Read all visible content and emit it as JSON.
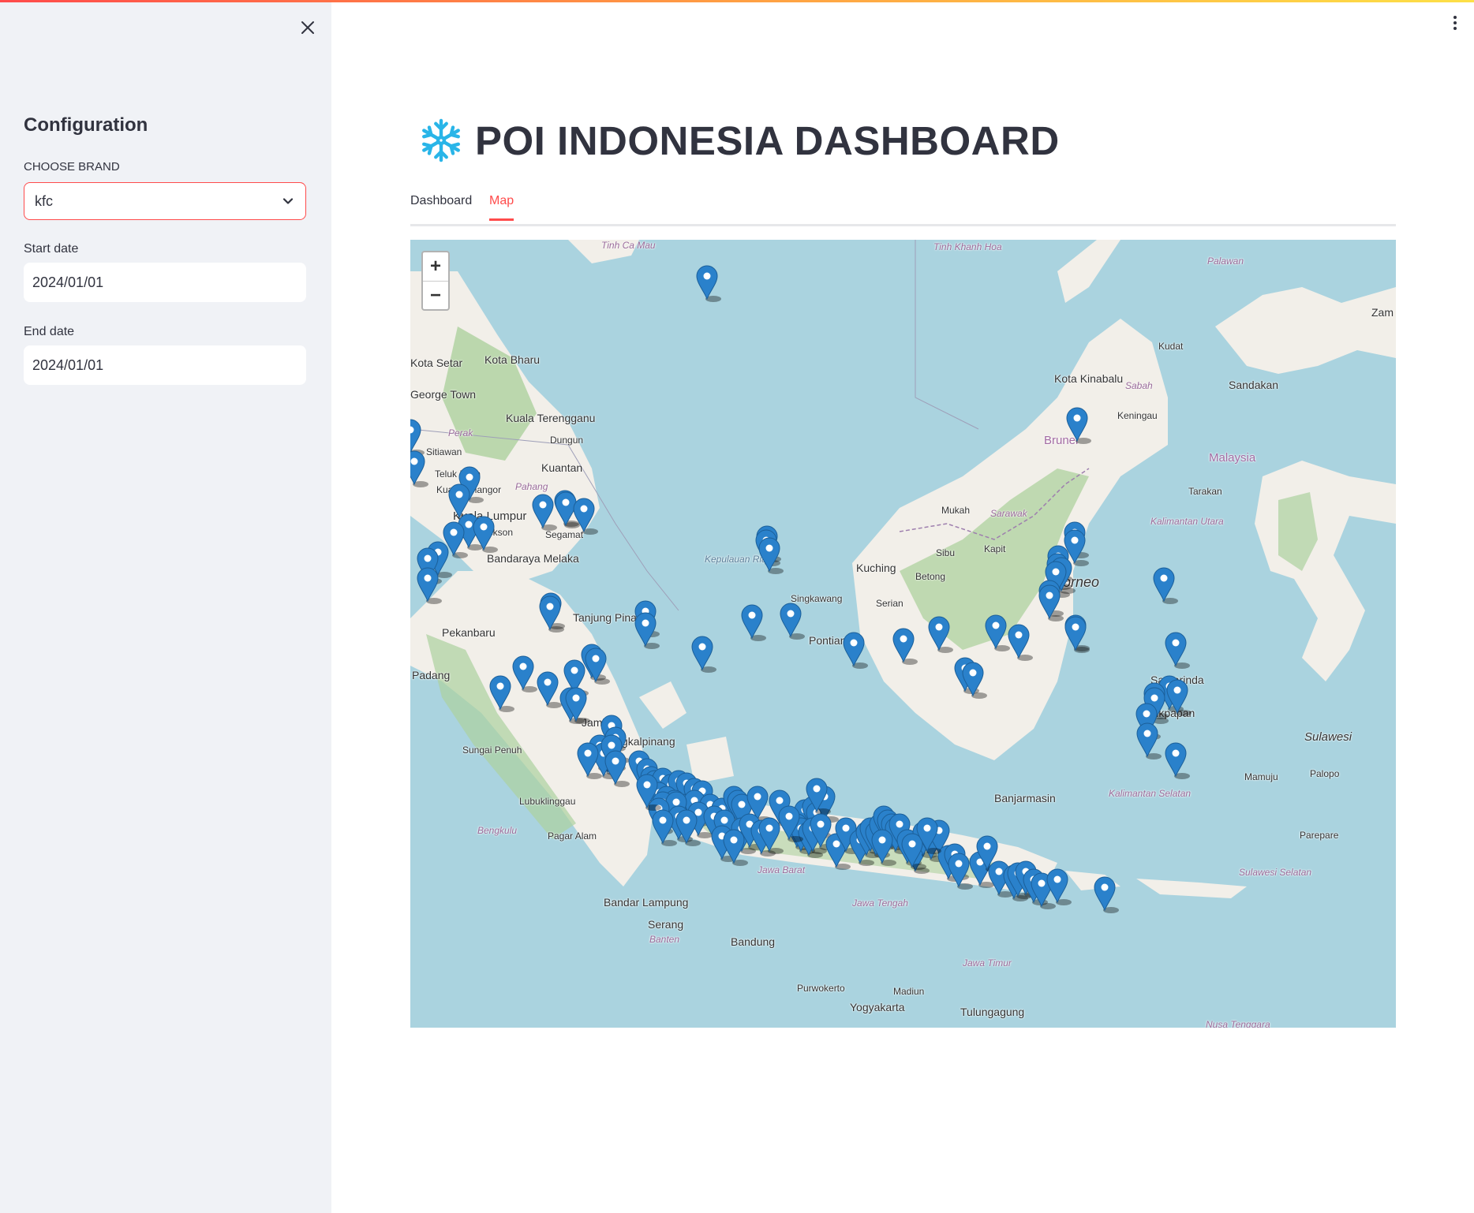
{
  "sidebar": {
    "title": "Configuration",
    "brand_label": "CHOOSE BRAND",
    "brand_value": "kfc",
    "start_label": "Start date",
    "start_value": "2024/01/01",
    "end_label": "End date",
    "end_value": "2024/01/01"
  },
  "header": {
    "icon": "snowflake-icon",
    "title": "POI INDONESIA DASHBOARD"
  },
  "tabs": [
    {
      "label": "Dashboard",
      "active": false
    },
    {
      "label": "Map",
      "active": true
    }
  ],
  "map": {
    "zoom_in": "+",
    "zoom_out": "−",
    "marker_color": "#2a81cb",
    "marker_count": 160,
    "labels": [
      "Kota Bharu",
      "Kuala Terengganu",
      "Dungun",
      "Kuantan",
      "Sitiawan",
      "Teluk Intan",
      "Kuala Selangor",
      "Kuala Lumpur",
      "Port Dickson",
      "Segamat",
      "Bandaraya Melaka",
      "Pekanbaru",
      "Tanjung Pinang",
      "Jambi",
      "Pangkalpinang",
      "Sungai Penuh",
      "Lubuklinggau",
      "Pagar Alam",
      "Bandar Lampung",
      "Serang",
      "Banten",
      "Bandung",
      "Purwokerto",
      "Yogyakarta",
      "Tulungagung",
      "Madiun",
      "Kuching",
      "Serian",
      "Betong",
      "Sibu",
      "Kapit",
      "Mukah",
      "Brunei",
      "Kota Kinabalu",
      "Kudat",
      "Sandakan",
      "Keningau",
      "Malaysia",
      "Borneo",
      "Pontianak",
      "Singkawang",
      "Banjarmasin",
      "Balikpapan",
      "Samarinda",
      "Tarakan",
      "Mamuju",
      "Parepare",
      "Palopo",
      "Sulawesi",
      "Kota Setar",
      "George Town",
      "Padang",
      "Bengkulu",
      "Jawa Barat",
      "Jawa Tengah",
      "Jawa Timur",
      "Nusa Tenggara",
      "Kepulauan Riau",
      "Kalimantan Utara",
      "Kalimantan Selatan",
      "Sulawesi Selatan",
      "Sabah",
      "Sarawak",
      "Perak",
      "Pahang",
      "Palawan",
      "Tinh Khanh Hoa",
      "Tinh Ca Mau",
      "Zam"
    ]
  },
  "colors": {
    "accent": "#ff4b4b",
    "sidebar_bg": "#f0f2f6",
    "sea": "#aad3df",
    "land": "#f2efe9",
    "forest": "#add19e",
    "icon_blue": "#29b5e8"
  }
}
